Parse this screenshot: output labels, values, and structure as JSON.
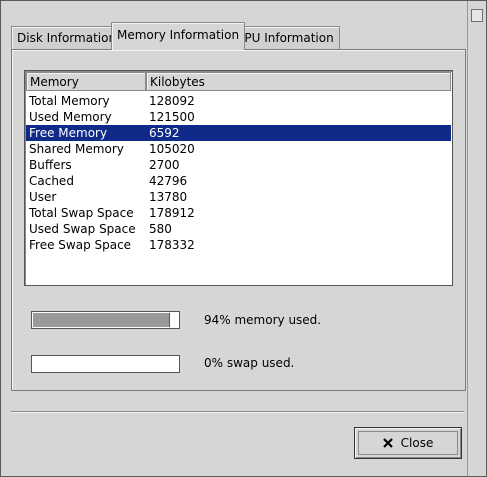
{
  "tabs": [
    {
      "label": "Disk Information",
      "active": false
    },
    {
      "label": "Memory Information",
      "active": true
    },
    {
      "label": "CPU Information",
      "active": false
    }
  ],
  "table": {
    "columns": [
      "Memory",
      "Kilobytes"
    ],
    "rows": [
      {
        "name": "Total Memory",
        "value": "128092",
        "selected": false
      },
      {
        "name": "Used Memory",
        "value": "121500",
        "selected": false
      },
      {
        "name": "Free Memory",
        "value": "6592",
        "selected": true
      },
      {
        "name": "Shared Memory",
        "value": "105020",
        "selected": false
      },
      {
        "name": "Buffers",
        "value": "2700",
        "selected": false
      },
      {
        "name": "Cached",
        "value": "42796",
        "selected": false
      },
      {
        "name": "User",
        "value": "13780",
        "selected": false
      },
      {
        "name": "Total Swap Space",
        "value": "178912",
        "selected": false
      },
      {
        "name": "Used Swap Space",
        "value": "580",
        "selected": false
      },
      {
        "name": "Free Swap Space",
        "value": "178332",
        "selected": false
      }
    ]
  },
  "memory_bar": {
    "label": "94% memory used.",
    "percent": 94
  },
  "swap_bar": {
    "label": "0% swap used.",
    "percent": 0
  },
  "close_button": {
    "label": "Close",
    "icon": "close-x-icon"
  },
  "colors": {
    "selection": "#102a8a",
    "window_bg": "#d6d6d6"
  }
}
